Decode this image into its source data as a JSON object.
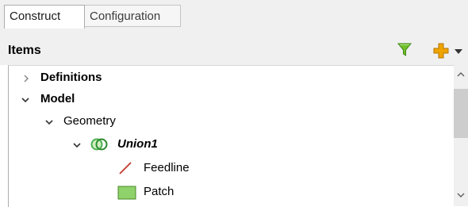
{
  "tabs": [
    {
      "label": "Construct",
      "active": true
    },
    {
      "label": "Configuration",
      "active": false
    }
  ],
  "items_panel": {
    "title": "Items",
    "filter_icon": "filter-funnel-icon",
    "add_icon": "add-plus-icon"
  },
  "tree": {
    "definitions": "Definitions",
    "model": "Model",
    "geometry": "Geometry",
    "union": "Union1",
    "feedline": "Feedline",
    "patch": "Patch"
  },
  "colors": {
    "filter_green": "#6fbf2a",
    "add_orange": "#f0a400",
    "feedline_red": "#c0392b",
    "patch_green": "#8fd16a",
    "union_green": "#4caf50"
  }
}
